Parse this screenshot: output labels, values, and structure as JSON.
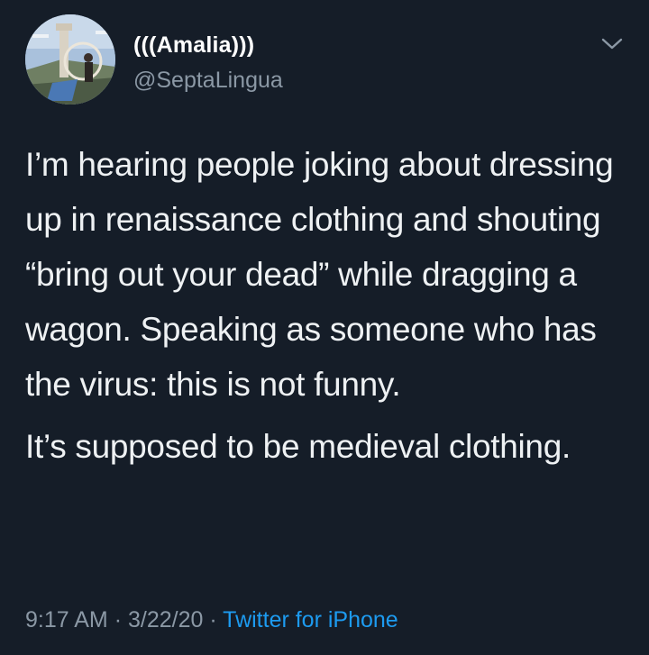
{
  "tweet": {
    "display_name": "(((Amalia)))",
    "handle": "@SeptaLingua",
    "paragraph1": "I’m hearing people joking about dressing up in renaissance clothing and shouting “bring out your dead” while dragging a wagon. Speaking as someone who has the virus: this is not funny.",
    "paragraph2": "It’s supposed to be medieval clothing.",
    "time": "9:17 AM",
    "date": "3/22/20",
    "separator": "·",
    "source": "Twitter for iPhone"
  },
  "icons": {
    "menu": "chevron-down-icon",
    "avatar": "profile-photo"
  },
  "colors": {
    "background": "#151d28",
    "text": "#eef1f3",
    "secondary": "#8b98a5",
    "link": "#1d9bf0"
  }
}
